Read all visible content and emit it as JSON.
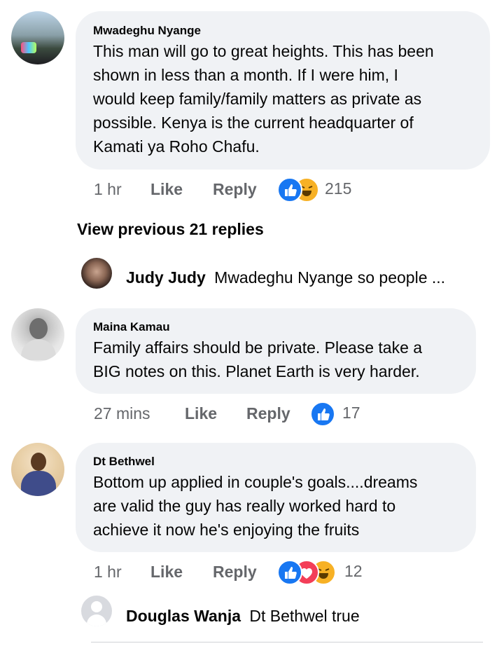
{
  "comments": [
    {
      "author": "Mwadeghu Nyange",
      "lines": [
        "This man will go to great heights. This has been",
        "shown in less than a month. If I were him, I",
        "would keep family/family matters as private as",
        "possible. Kenya is the current headquarter of",
        "Kamati ya Roho Chafu."
      ],
      "time": "1 hr",
      "like": "Like",
      "reply": "Reply",
      "reactions": "215",
      "reaction_icons": [
        "like-icon",
        "haha-icon"
      ]
    },
    {
      "author": "Maina Kamau",
      "lines": [
        "Family affairs should be private. Please take a",
        "BIG notes on this. Planet Earth is very harder."
      ],
      "time": "27 mins",
      "like": "Like",
      "reply": "Reply",
      "reactions": "17",
      "reaction_icons": [
        "like-icon"
      ]
    },
    {
      "author": "Dt Bethwel",
      "lines": [
        "Bottom up applied in couple's goals....dreams",
        "are valid the guy has really worked hard to",
        "achieve it now he's enjoying the fruits"
      ],
      "time": "1 hr",
      "like": "Like",
      "reply": "Reply",
      "reactions": "12",
      "reaction_icons": [
        "like-icon",
        "love-icon",
        "haha-icon"
      ]
    }
  ],
  "view_previous": "View previous 21 replies",
  "reply_previews": [
    {
      "author": "Judy Judy",
      "text": "Mwadeghu Nyange so people ..."
    },
    {
      "author": "Douglas Wanja",
      "text": "Dt Bethwel true"
    }
  ],
  "colors": {
    "like_blue": "#1877f2",
    "love_red": "#f33e58",
    "haha_yellow": "#f7b125",
    "bubble": "#f0f2f5",
    "meta": "#65676b"
  }
}
